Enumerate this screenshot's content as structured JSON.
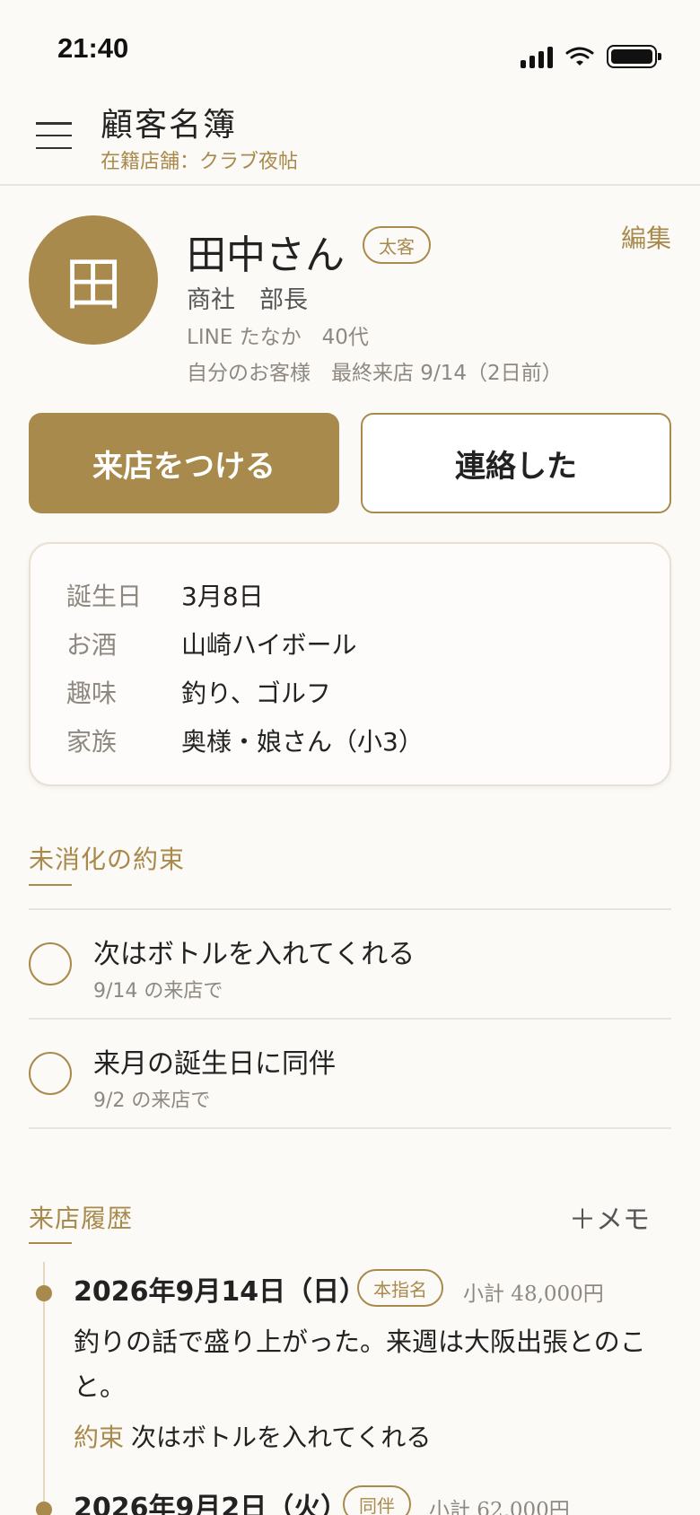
{
  "status_bar": {
    "time": "21:40"
  },
  "header": {
    "title": "顧客名簿",
    "subtitle": "在籍店舗：クラブ夜帖"
  },
  "customer": {
    "avatar_initial": "田",
    "name": "田中さん",
    "tag": "太客",
    "role": "商社　部長",
    "line_info": "LINE たなか　40代",
    "owner_last_visit": "自分のお客様　最終来店 9/14（2日前）",
    "edit_label": "編集"
  },
  "actions": {
    "visit_label": "来店をつける",
    "contact_label": "連絡した"
  },
  "info": [
    {
      "label": "誕生日",
      "value": "3月8日"
    },
    {
      "label": "お酒",
      "value": "山崎ハイボール"
    },
    {
      "label": "趣味",
      "value": "釣り、ゴルフ"
    },
    {
      "label": "家族",
      "value": "奥様・娘さん（小3）"
    }
  ],
  "promises": {
    "heading": "未消化の約束",
    "items": [
      {
        "title": "次はボトルを入れてくれる",
        "sub": "9/14 の来店で"
      },
      {
        "title": "来月の誕生日に同伴",
        "sub": "9/2 の来店で"
      }
    ]
  },
  "history": {
    "heading": "来店履歴",
    "memo_label": "＋メモ",
    "visits": [
      {
        "date": "2026年9月14日（日）",
        "badge": "本指名",
        "subtotal": "小計 48,000円",
        "note": "釣りの話で盛り上がった。来週は大阪出張とのこと。",
        "promise_label": "約束",
        "promise_text": "次はボトルを入れてくれる"
      },
      {
        "date": "2026年9月2日（火）",
        "badge": "同伴",
        "subtotal": "小計 62,000円"
      }
    ]
  },
  "colors": {
    "accent": "#a88a4c",
    "background": "#fcfaf7",
    "muted_text": "#8e8880"
  }
}
